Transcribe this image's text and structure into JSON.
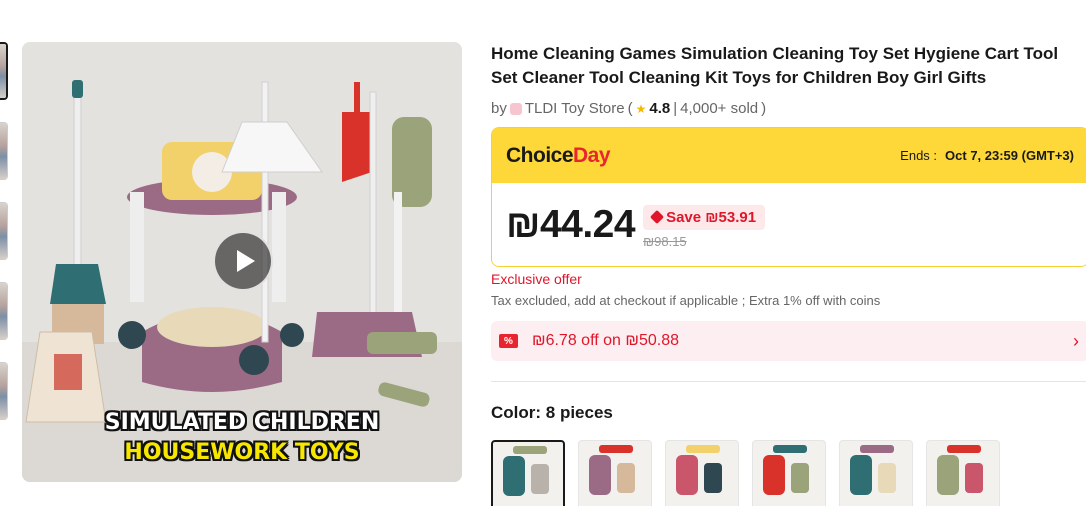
{
  "product": {
    "title": "Home Cleaning Games Simulation Cleaning Toy Set Hygiene Cart Tool Set Cleaner Tool Cleaning Kit Toys for Children Boy Girl Gifts",
    "by_prefix": "by",
    "store_name": "TLDI Toy Store",
    "open_paren": "(",
    "rating": "4.8",
    "separator": "|",
    "sold": "4,000+ sold",
    "close_paren": ")"
  },
  "media": {
    "caption_line1": "SIMULATED CHILDREN",
    "caption_line2": "HOUSEWORK TOYS",
    "thumb_count": 5
  },
  "promo": {
    "logo_part1": "Choice",
    "logo_part2": "Day",
    "ends_label": "Ends :",
    "ends_value": "Oct 7, 23:59 (GMT+3)"
  },
  "price": {
    "current": "₪44.24",
    "save_label": "Save ₪53.91",
    "original": "₪98.15"
  },
  "offer": {
    "exclusive": "Exclusive offer",
    "tax_note": "Tax excluded, add at checkout if applicable ; Extra 1% off with coins"
  },
  "coupon": {
    "icon_text": "%",
    "text": "₪6.78 off on ₪50.88",
    "chevron": "›"
  },
  "variant": {
    "label": "Color: 8 pieces"
  },
  "colors": {
    "accent_red": "#e0162b",
    "choice_yellow": "#fdd838",
    "toy_purple": "#9b6b86",
    "toy_teal": "#2f6f73"
  }
}
